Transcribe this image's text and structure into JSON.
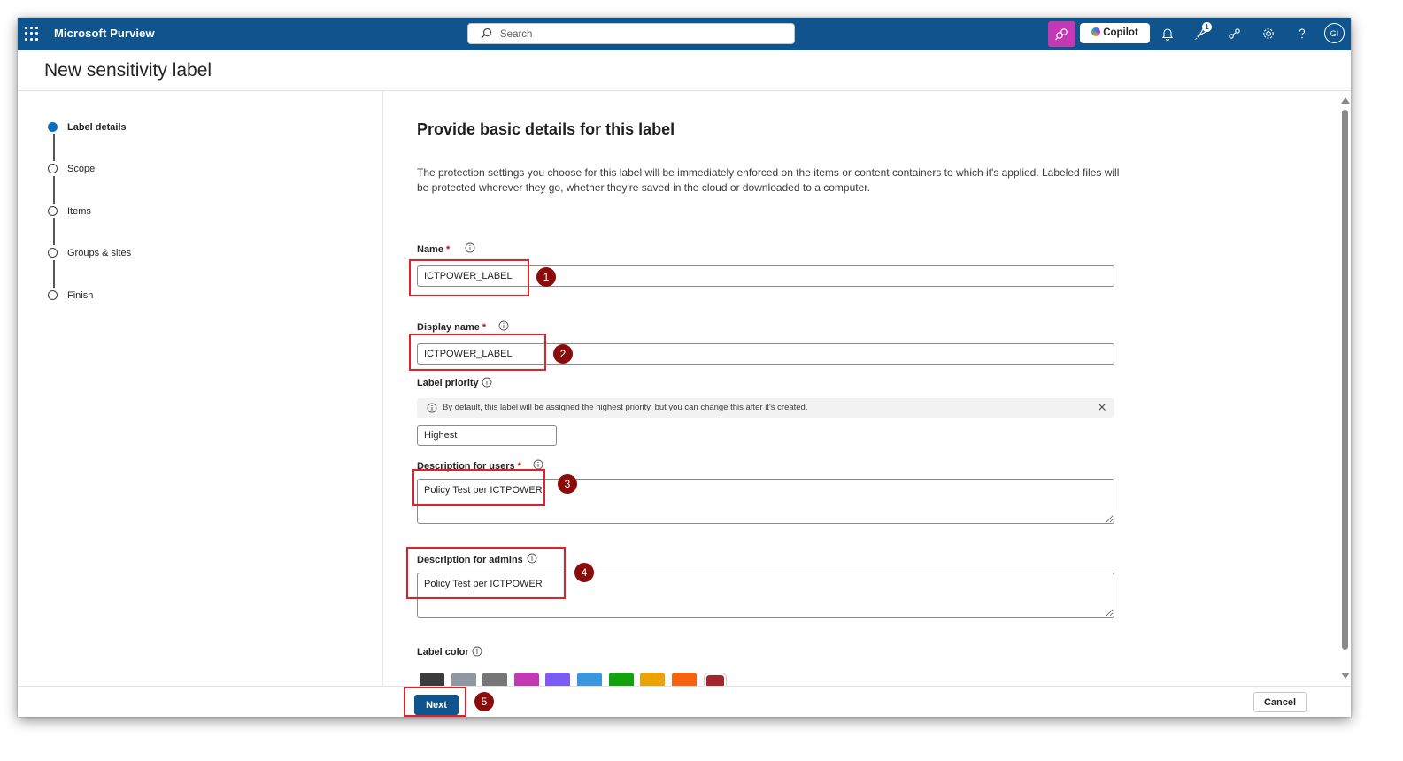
{
  "app": {
    "title": "Microsoft Purview",
    "search_placeholder": "Search",
    "copilot_label": "Copilot",
    "notification_count": "1",
    "avatar_initials": "GI",
    "icons": [
      "app-launcher-icon",
      "search-icon",
      "copilot-icon",
      "bell-icon",
      "rocket-icon",
      "share-icon",
      "gear-icon",
      "help-icon"
    ]
  },
  "page": {
    "title": "New sensitivity label"
  },
  "steps": [
    {
      "label": "Label details",
      "active": true
    },
    {
      "label": "Scope",
      "active": false
    },
    {
      "label": "Items",
      "active": false
    },
    {
      "label": "Groups & sites",
      "active": false
    },
    {
      "label": "Finish",
      "active": false
    }
  ],
  "main": {
    "section_title": "Provide basic details for this label",
    "intro": "The protection settings you choose for this label will be immediately enforced on the items or content containers to which it's applied. Labeled files will be protected wherever they go, whether they're saved in the cloud or downloaded to a computer.",
    "name": {
      "label": "Name",
      "required_mark": "*",
      "value": "ICTPOWER_LABEL"
    },
    "display_name": {
      "label": "Display name",
      "required_mark": "*",
      "value": "ICTPOWER_LABEL"
    },
    "label_priority": {
      "label": "Label priority",
      "notice": "By default, this label will be assigned the highest priority, but you can change this after it's created.",
      "value": "Highest"
    },
    "description_users": {
      "label": "Description for users",
      "required_mark": "*",
      "value": "Policy Test per ICTPOWER"
    },
    "description_admins": {
      "label": "Description for admins",
      "value": "Policy Test per ICTPOWER"
    },
    "label_color": {
      "label": "Label color",
      "swatches": [
        "#3b3b3b",
        "#8d98a0",
        "#767676",
        "#c239b3",
        "#7b5af5",
        "#3a96dd",
        "#13a10e",
        "#eaa300",
        "#f7630c",
        "#a4262c"
      ]
    }
  },
  "footer": {
    "next_label": "Next",
    "cancel_label": "Cancel"
  },
  "annotations": [
    "1",
    "2",
    "3",
    "4",
    "5"
  ],
  "colors": {
    "topbar": "#0f548c",
    "primary_button": "#0f548c",
    "callout_border": "#e0202a",
    "callout_number": "#8b0a0a",
    "active_step": "#0f6cbd"
  }
}
